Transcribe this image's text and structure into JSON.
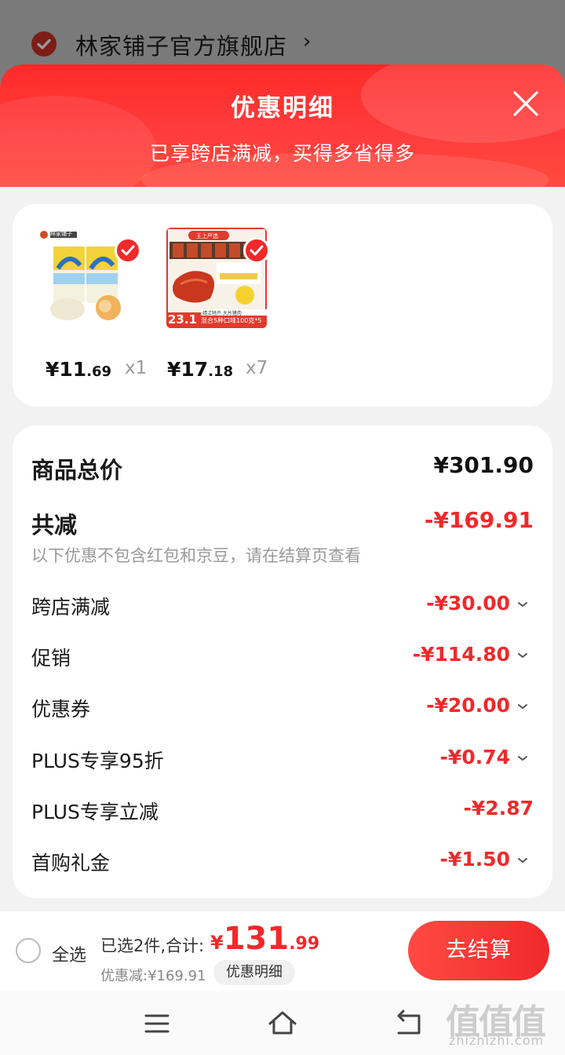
{
  "store": {
    "name": "林家铺子官方旗舰店",
    "chevron": "›"
  },
  "sheet": {
    "title": "优惠明细",
    "subtitle": "已享跨店满减，买得多省得多"
  },
  "products": [
    {
      "price_int": "¥11",
      "price_dec": ".69",
      "qty": "x1",
      "brand": "林家铺子"
    },
    {
      "price_int": "¥17",
      "price_dec": ".18",
      "qty": "x7",
      "brand": "王上严选",
      "banner_num": "23.1",
      "banner_text": "混合5种口味100克*5",
      "sub_text": "靖江特产 大片猪肉"
    }
  ],
  "breakdown": {
    "total_label": "商品总价",
    "total_value": "¥301.90",
    "reduce_label": "共减",
    "reduce_value": "-¥169.91",
    "note": "以下优惠不包含红包和京豆，请在结算页查看",
    "items": [
      {
        "label": "跨店满减",
        "value": "-¥30.00"
      },
      {
        "label": "促销",
        "value": "-¥114.80"
      },
      {
        "label": "优惠券",
        "value": "-¥20.00"
      },
      {
        "label": "PLUS专享95折",
        "value": "-¥0.74"
      },
      {
        "label": "PLUS专享立减",
        "value": "-¥2.87"
      },
      {
        "label": "首购礼金",
        "value": "-¥1.50"
      }
    ]
  },
  "bottom": {
    "select_all": "全选",
    "summary": "已选2件,合计:",
    "total_cur": "¥",
    "total_int": "131",
    "total_dec": ".99",
    "saved": "优惠减:¥169.91",
    "detail_btn": "优惠明细",
    "checkout": "去结算"
  },
  "watermark": {
    "logo": "值值值",
    "url": "zhizhizhi.com"
  },
  "colors": {
    "accent": "#f0292b",
    "header": "#ff2a2a"
  }
}
